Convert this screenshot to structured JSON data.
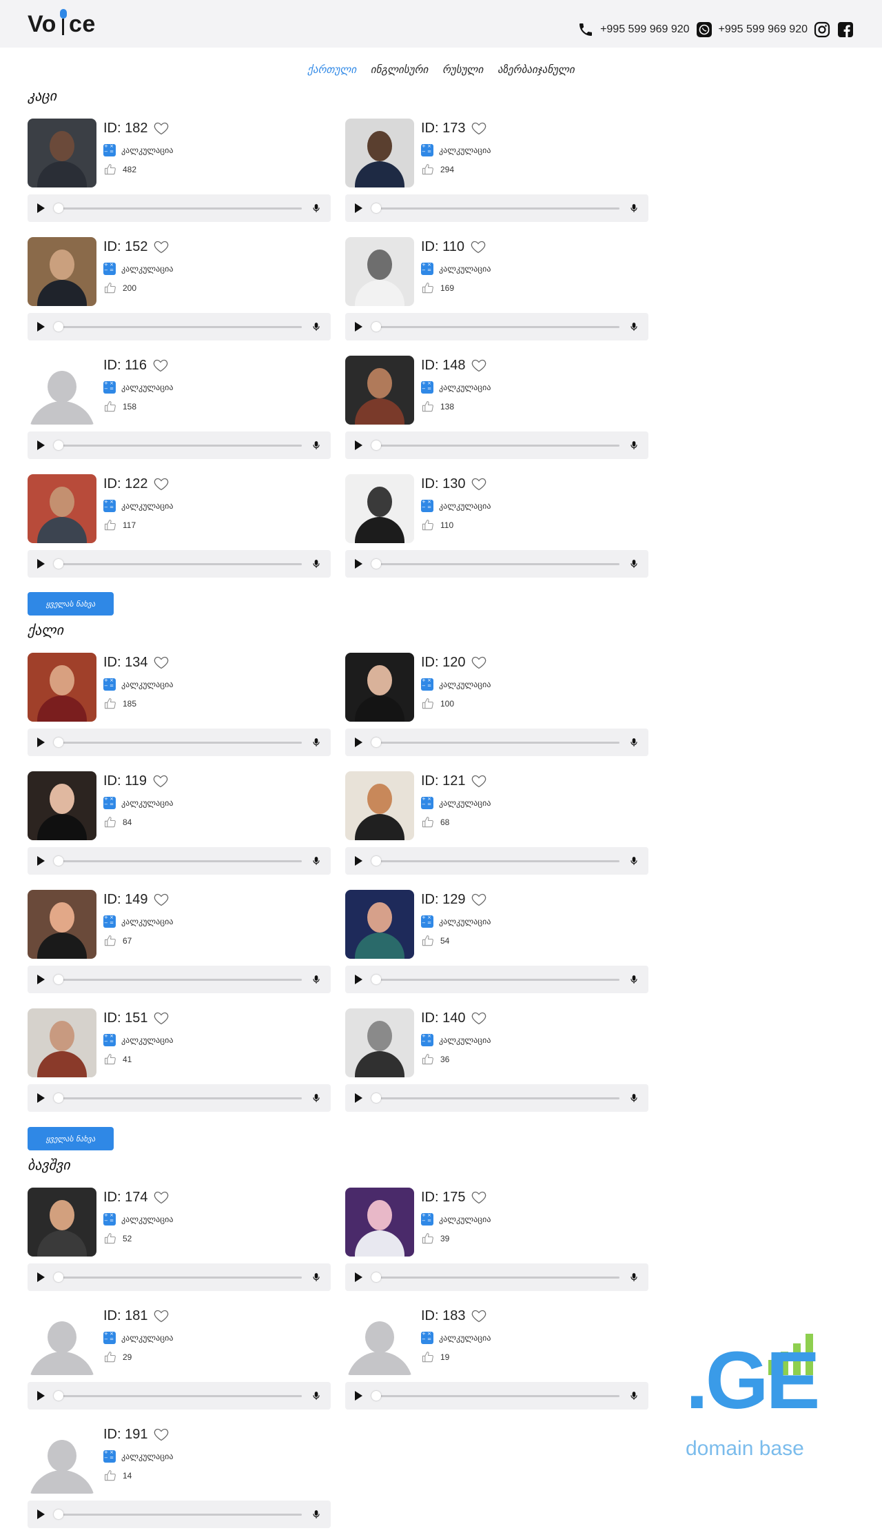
{
  "header": {
    "logo_left": "Vo",
    "logo_right": "ce",
    "phone_1": "+995 599 969 920",
    "phone_2": "+995 599 969 920"
  },
  "languages": [
    "ქართული",
    "ინგლისური",
    "რუსული",
    "აზერბაიჯანული"
  ],
  "active_language": "ქართული",
  "calc_label": "კალკულაცია",
  "show_all_label": "ყველას ნახვა",
  "sections": [
    {
      "title": "კაცი",
      "cards": [
        {
          "id": "ID: 182",
          "likes": "482"
        },
        {
          "id": "ID: 173",
          "likes": "294"
        },
        {
          "id": "ID: 152",
          "likes": "200"
        },
        {
          "id": "ID: 110",
          "likes": "169"
        },
        {
          "id": "ID: 116",
          "likes": "158"
        },
        {
          "id": "ID: 148",
          "likes": "138"
        },
        {
          "id": "ID: 122",
          "likes": "117"
        },
        {
          "id": "ID: 130",
          "likes": "110"
        }
      ]
    },
    {
      "title": "ქალი",
      "cards": [
        {
          "id": "ID: 134",
          "likes": "185"
        },
        {
          "id": "ID: 120",
          "likes": "100"
        },
        {
          "id": "ID: 119",
          "likes": "84"
        },
        {
          "id": "ID: 121",
          "likes": "68"
        },
        {
          "id": "ID: 149",
          "likes": "67"
        },
        {
          "id": "ID: 129",
          "likes": "54"
        },
        {
          "id": "ID: 151",
          "likes": "41"
        },
        {
          "id": "ID: 140",
          "likes": "36"
        }
      ]
    },
    {
      "title": "ბავშვი",
      "cards": [
        {
          "id": "ID: 174",
          "likes": "52"
        },
        {
          "id": "ID: 175",
          "likes": "39"
        },
        {
          "id": "ID: 181",
          "likes": "29"
        },
        {
          "id": "ID: 183",
          "likes": "19"
        },
        {
          "id": "ID: 191",
          "likes": "14"
        }
      ]
    }
  ],
  "brand": {
    "mark": ".GE",
    "tagline": "domain base"
  },
  "colors": {
    "accent": "#2f88e6",
    "brand_blue": "#3a9be8",
    "brand_green": "#8ecf4f"
  }
}
